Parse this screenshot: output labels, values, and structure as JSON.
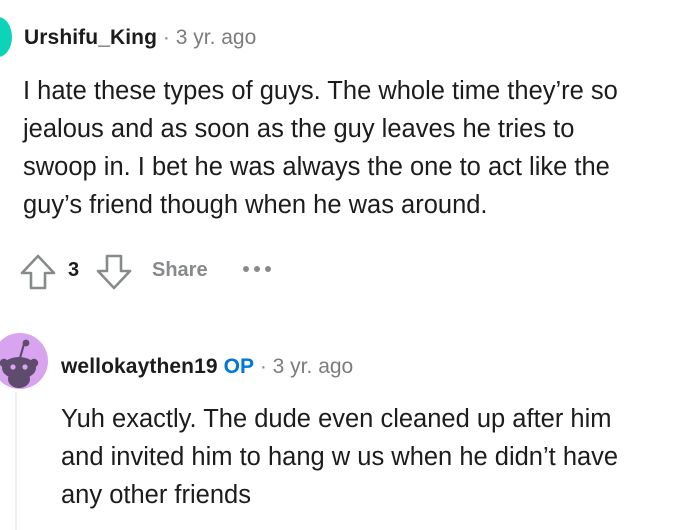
{
  "comments": [
    {
      "author": "Urshifu_King",
      "separator": "·",
      "time": "3 yr. ago",
      "body": "I hate these types of guys. The whole time they’re so\njealous and as soon as the guy leaves he tries to\nswoop in. I bet he was always the one to act like the\nguy’s friend though when he was around.",
      "score": "3",
      "share_label": "Share",
      "avatar_color": "#0dd3bb"
    },
    {
      "author": "wellokaythen19",
      "op_badge": "OP",
      "separator": "·",
      "time": "3 yr. ago",
      "body": "Yuh exactly. The dude even cleaned up after him\nand invited him to hang w us when he didn’t have\nany other friends",
      "avatar_color": "#d8a4f0"
    }
  ],
  "colors": {
    "muted": "#878a8c",
    "op_blue": "#0079d3",
    "text": "#1c1c1c"
  },
  "icons": [
    "upvote-icon",
    "downvote-icon",
    "more-options-icon",
    "snoo-avatar-icon"
  ]
}
